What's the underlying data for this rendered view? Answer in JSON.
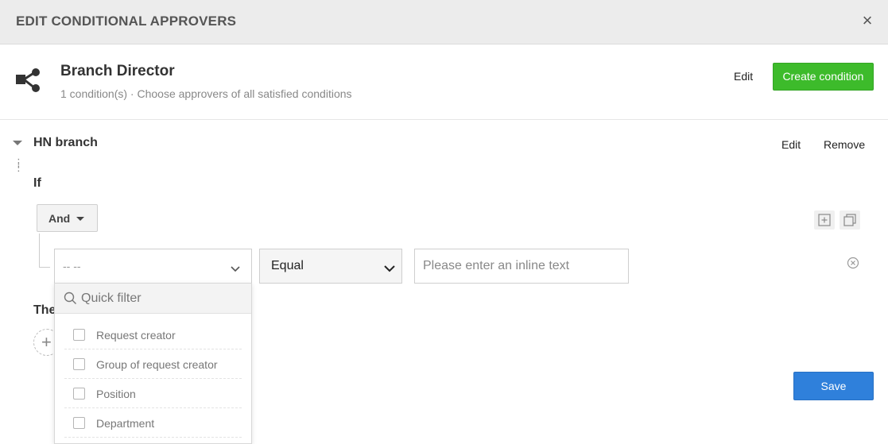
{
  "dialog": {
    "title": "EDIT CONDITIONAL APPROVERS",
    "close_glyph": "×"
  },
  "approver": {
    "name": "Branch Director",
    "summary": "1 condition(s) · Choose approvers of all satisfied conditions",
    "icon": "share-nodes-icon",
    "edit_label": "Edit",
    "create_label": "Create condition",
    "create_color": "#3dbb2b"
  },
  "condition": {
    "name": "HN branch",
    "edit_label": "Edit",
    "remove_label": "Remove",
    "if_label": "If",
    "then_label": "The",
    "logic_label": "And",
    "rule": {
      "field_value": "-- --",
      "operator_value": "Equal",
      "value_placeholder": "Please enter an inline text"
    }
  },
  "field_dropdown": {
    "filter_placeholder": "Quick filter",
    "options": [
      "Request creator",
      "Group of request creator",
      "Position",
      "Department"
    ]
  },
  "footer": {
    "save_label": "Save",
    "save_color": "#2f80db"
  }
}
